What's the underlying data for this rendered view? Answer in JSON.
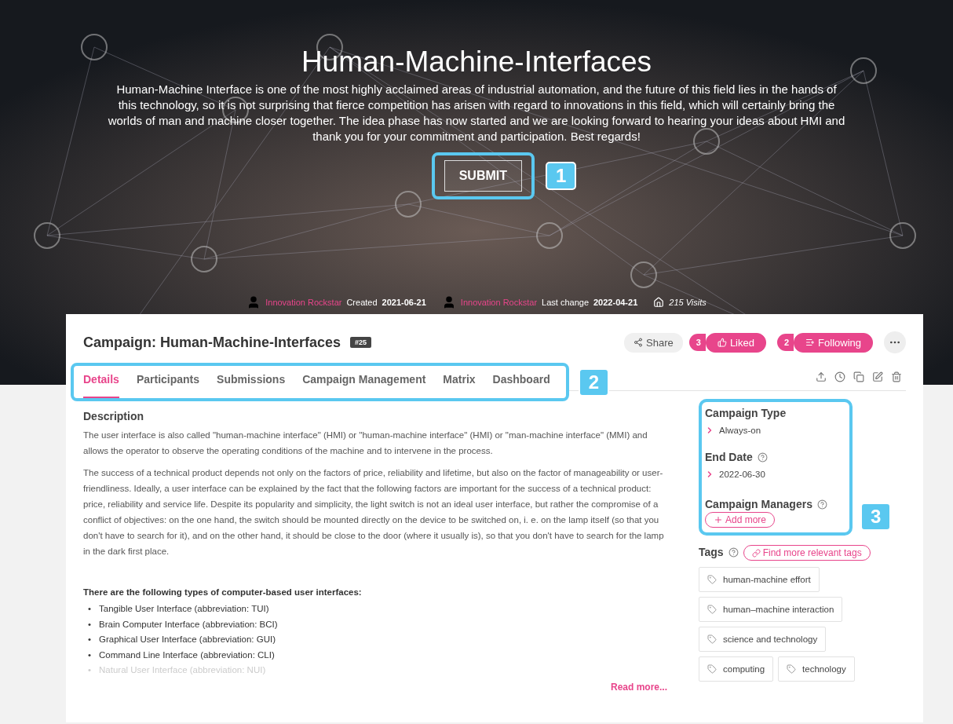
{
  "hero": {
    "title": "Human-Machine-Interfaces",
    "description": "Human-Machine Interface is one of the most highly acclaimed areas of industrial automation, and the future of this field lies in the hands of this technology, so it is not surprising that fierce competition has arisen with regard to innovations in this field, which will certainly bring the worlds of man and machine closer together. The idea phase has now started and we are looking forward to hearing your ideas about HMI and thank you for your commitment and participation. Best regards!",
    "submit": "SUBMIT",
    "callout": "1"
  },
  "meta": {
    "creator": "Innovation Rockstar",
    "created_label": "Created",
    "created_date": "2021-06-21",
    "editor": "Innovation Rockstar",
    "changed_label": "Last change",
    "changed_date": "2022-04-21",
    "visits": "215 Visits"
  },
  "campaign": {
    "title": "Campaign: Human-Machine-Interfaces",
    "number": "#25"
  },
  "actions": {
    "share": "Share",
    "likes": {
      "count": "3",
      "label": "Liked",
      "on": true
    },
    "follows": {
      "count": "2",
      "label": "Following",
      "on": true
    }
  },
  "tabs": [
    {
      "label": "Details",
      "selected": true
    },
    {
      "label": "Participants",
      "selected": false
    },
    {
      "label": "Submissions",
      "selected": false
    },
    {
      "label": "Campaign Management",
      "selected": false
    },
    {
      "label": "Matrix",
      "selected": false
    },
    {
      "label": "Dashboard",
      "selected": false
    }
  ],
  "tabs_callout": "2",
  "description": {
    "heading": "Description",
    "paragraphs": [
      "The user interface is also called \"human-machine interface\" (HMI) or \"human-machine interface\" (HMI) or \"man-machine interface\" (MMI) and allows the operator to observe the operating conditions of the machine and to intervene in the process.",
      "The success of a technical product depends not only on the factors of price, reliability and lifetime, but also on the factor of manageability or user-friendliness. Ideally, a user interface can be explained by the fact that the following factors are important for the success of a technical product: price, reliability and service life. Despite its popularity and simplicity, the light switch is not an ideal user interface, but rather the compromise of a conflict of objectives: on the one hand, the switch should be mounted directly on the device to be switched on, i. e. on the lamp itself (so that you don't have to search for it), and on the other hand, it should be close to the door (where it usually is), so that you don't have to search for the lamp in the dark first place."
    ],
    "list_heading": "There are the following types of computer-based user interfaces:",
    "items": [
      {
        "marker": "•",
        "text": "Tangible User Interface (abbreviation: TUI)",
        "faded": false
      },
      {
        "marker": "•",
        "text": "Brain Computer Interface (abbreviation: BCI)",
        "faded": false
      },
      {
        "marker": "•",
        "text": "Graphical User Interface (abbreviation: GUI)",
        "faded": false
      },
      {
        "marker": "•",
        "text": "Command Line Interface (abbreviation: CLI)",
        "faded": false
      },
      {
        "marker": "•",
        "text": "Natural User Interface (abbreviation: NUI)",
        "faded": true
      }
    ],
    "read_more": "Read more..."
  },
  "sidebar": {
    "type_label": "Campaign Type",
    "type_value": "Always-on",
    "end_label": "End Date",
    "end_value": "2022-06-30",
    "managers_label": "Campaign Managers",
    "add_more": "Add more",
    "callout": "3",
    "tags_label": "Tags",
    "find_tags": "Find more relevant tags",
    "tags": [
      "human-machine effort",
      "human–machine interaction",
      "science and technology",
      "computing",
      "technology"
    ]
  }
}
